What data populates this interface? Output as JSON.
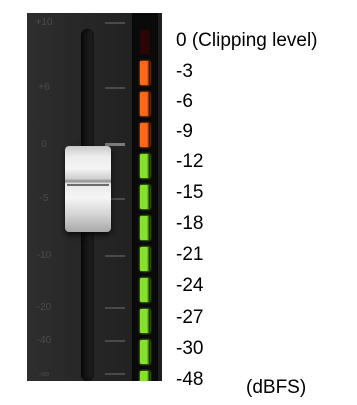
{
  "fader_scale": [
    "+10",
    "+6",
    "0",
    "-5",
    "-10",
    "-20",
    "-40",
    "-∞"
  ],
  "meter": {
    "segments": [
      {
        "level": "0",
        "color": "#2a0505",
        "lit": false
      },
      {
        "level": "-3",
        "color": "#ff6a1a",
        "lit": true
      },
      {
        "level": "-6",
        "color": "#ff6a1a",
        "lit": true
      },
      {
        "level": "-9",
        "color": "#ff6a1a",
        "lit": true
      },
      {
        "level": "-12",
        "color": "#86e12a",
        "lit": true
      },
      {
        "level": "-15",
        "color": "#86e12a",
        "lit": true
      },
      {
        "level": "-18",
        "color": "#86e12a",
        "lit": true
      },
      {
        "level": "-21",
        "color": "#86e12a",
        "lit": true
      },
      {
        "level": "-24",
        "color": "#86e12a",
        "lit": true
      },
      {
        "level": "-27",
        "color": "#86e12a",
        "lit": true
      },
      {
        "level": "-30",
        "color": "#86e12a",
        "lit": true
      },
      {
        "level": "-48",
        "color": "#86e12a",
        "lit": true
      }
    ]
  },
  "legend": {
    "labels": [
      "0 (Clipping level)",
      "-3",
      "-6",
      "-9",
      "-12",
      "-15",
      "-18",
      "-21",
      "-24",
      "-27",
      "-30",
      "-48"
    ],
    "unit": "(dBFS)"
  },
  "fader": {
    "position_db": "-5"
  }
}
